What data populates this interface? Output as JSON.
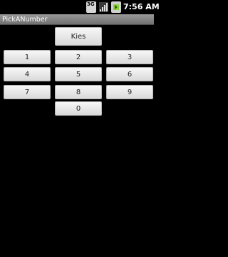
{
  "status_bar": {
    "network_label": "3G",
    "time": "7:56 AM",
    "icons": [
      "3g-icon",
      "signal-icon",
      "battery-icon"
    ]
  },
  "title_bar": {
    "title": "PickANumber"
  },
  "main": {
    "kies_label": "Kies",
    "keys": [
      {
        "label": "1"
      },
      {
        "label": "2"
      },
      {
        "label": "3"
      },
      {
        "label": "4"
      },
      {
        "label": "5"
      },
      {
        "label": "6"
      },
      {
        "label": "7"
      },
      {
        "label": "8"
      },
      {
        "label": "9"
      },
      {
        "label": "0"
      }
    ]
  },
  "colors": {
    "background": "#000000",
    "title_bar": "#808080",
    "button": "#e6e6e6",
    "battery_accent": "#8bd03a"
  }
}
